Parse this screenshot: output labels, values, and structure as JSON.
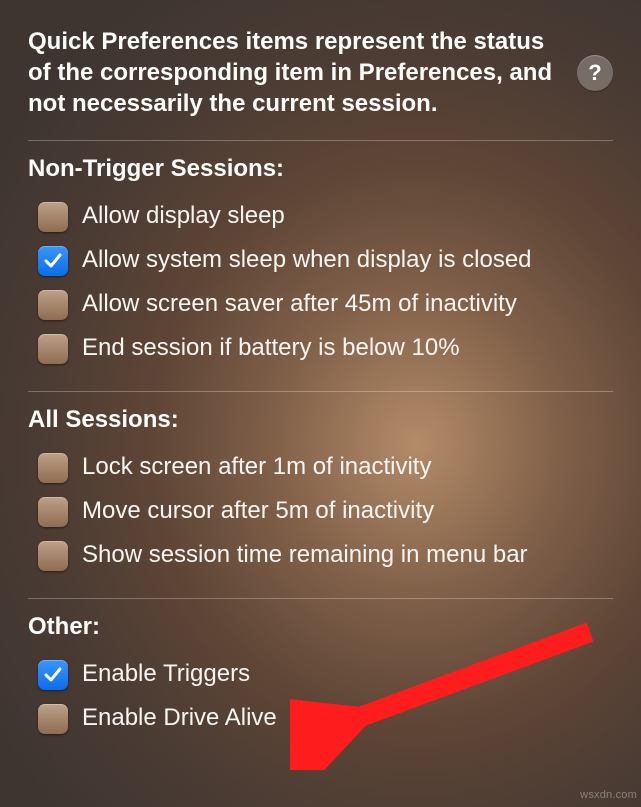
{
  "intro": "Quick Preferences items represent the status of the corresponding item in Preferences, and not necessarily the current session.",
  "help_glyph": "?",
  "sections": {
    "non_trigger": {
      "title": "Non-Trigger Sessions:",
      "items": [
        {
          "label": "Allow display sleep",
          "checked": false,
          "name": "allow-display-sleep"
        },
        {
          "label": "Allow system sleep when display is closed",
          "checked": true,
          "name": "allow-system-sleep-closed"
        },
        {
          "label": "Allow screen saver after 45m of inactivity",
          "checked": false,
          "name": "allow-screen-saver"
        },
        {
          "label": "End session if battery is below 10%",
          "checked": false,
          "name": "end-session-low-battery"
        }
      ]
    },
    "all": {
      "title": "All Sessions:",
      "items": [
        {
          "label": "Lock screen after 1m of inactivity",
          "checked": false,
          "name": "lock-screen-inactivity"
        },
        {
          "label": "Move cursor after 5m of inactivity",
          "checked": false,
          "name": "move-cursor-inactivity"
        },
        {
          "label": "Show session time remaining in menu bar",
          "checked": false,
          "name": "show-time-menu-bar"
        }
      ]
    },
    "other": {
      "title": "Other:",
      "items": [
        {
          "label": "Enable Triggers",
          "checked": true,
          "name": "enable-triggers"
        },
        {
          "label": "Enable Drive Alive",
          "checked": false,
          "name": "enable-drive-alive"
        }
      ]
    }
  },
  "watermark": "wsxdn.com"
}
